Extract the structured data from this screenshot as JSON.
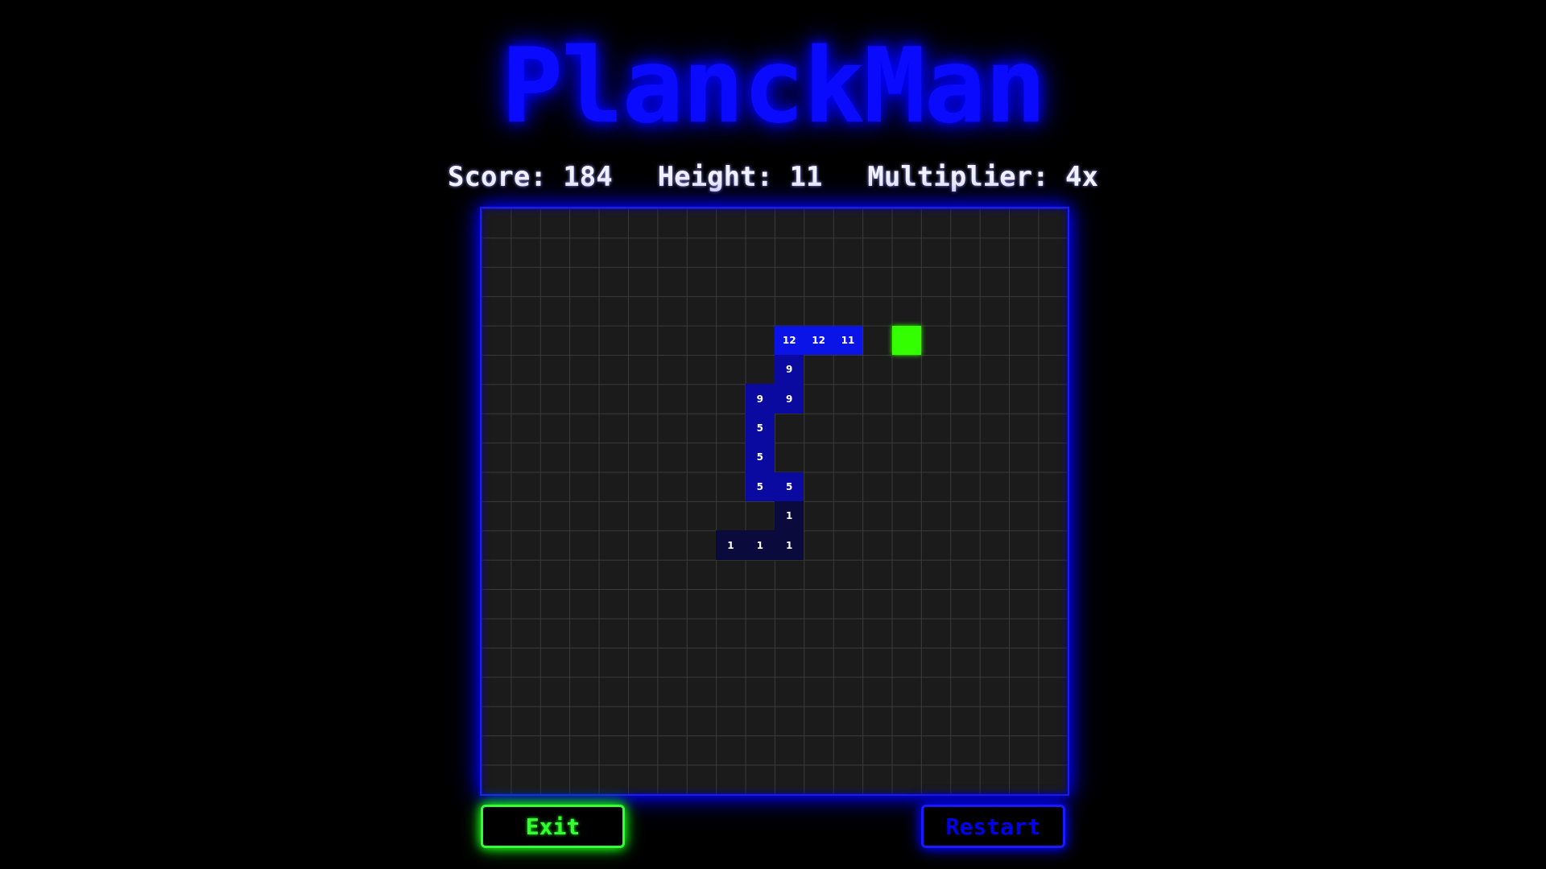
{
  "game": {
    "title": "PlanckMan"
  },
  "stats": {
    "score_label": "Score: 184",
    "height_label": "Height: 11",
    "multiplier_label": "Multiplier: 4x",
    "score": 184,
    "height": 11,
    "multiplier": "4x"
  },
  "board": {
    "columns": 20,
    "rows": 20,
    "snake": [
      {
        "col": 10,
        "row": 4,
        "value": "12"
      },
      {
        "col": 11,
        "row": 4,
        "value": "12"
      },
      {
        "col": 12,
        "row": 4,
        "value": "11"
      },
      {
        "col": 10,
        "row": 5,
        "value": "9"
      },
      {
        "col": 9,
        "row": 6,
        "value": "9"
      },
      {
        "col": 10,
        "row": 6,
        "value": "9"
      },
      {
        "col": 9,
        "row": 7,
        "value": "5"
      },
      {
        "col": 9,
        "row": 8,
        "value": "5"
      },
      {
        "col": 9,
        "row": 9,
        "value": "5"
      },
      {
        "col": 10,
        "row": 9,
        "value": "5"
      },
      {
        "col": 10,
        "row": 10,
        "value": "1"
      },
      {
        "col": 8,
        "row": 11,
        "value": "1"
      },
      {
        "col": 9,
        "row": 11,
        "value": "1"
      },
      {
        "col": 10,
        "row": 11,
        "value": "1"
      }
    ],
    "food": {
      "col": 14,
      "row": 4
    }
  },
  "buttons": {
    "exit_label": "Exit",
    "restart_label": "Restart"
  },
  "colors": {
    "title": "#0a0aff",
    "food": "#33ff00",
    "exit_accent": "#33ff33",
    "restart_accent": "#1a1aff",
    "cell_high": "#0a14e6",
    "cell_mid": "#0a0aa0",
    "cell_low": "#0a0a3c"
  }
}
